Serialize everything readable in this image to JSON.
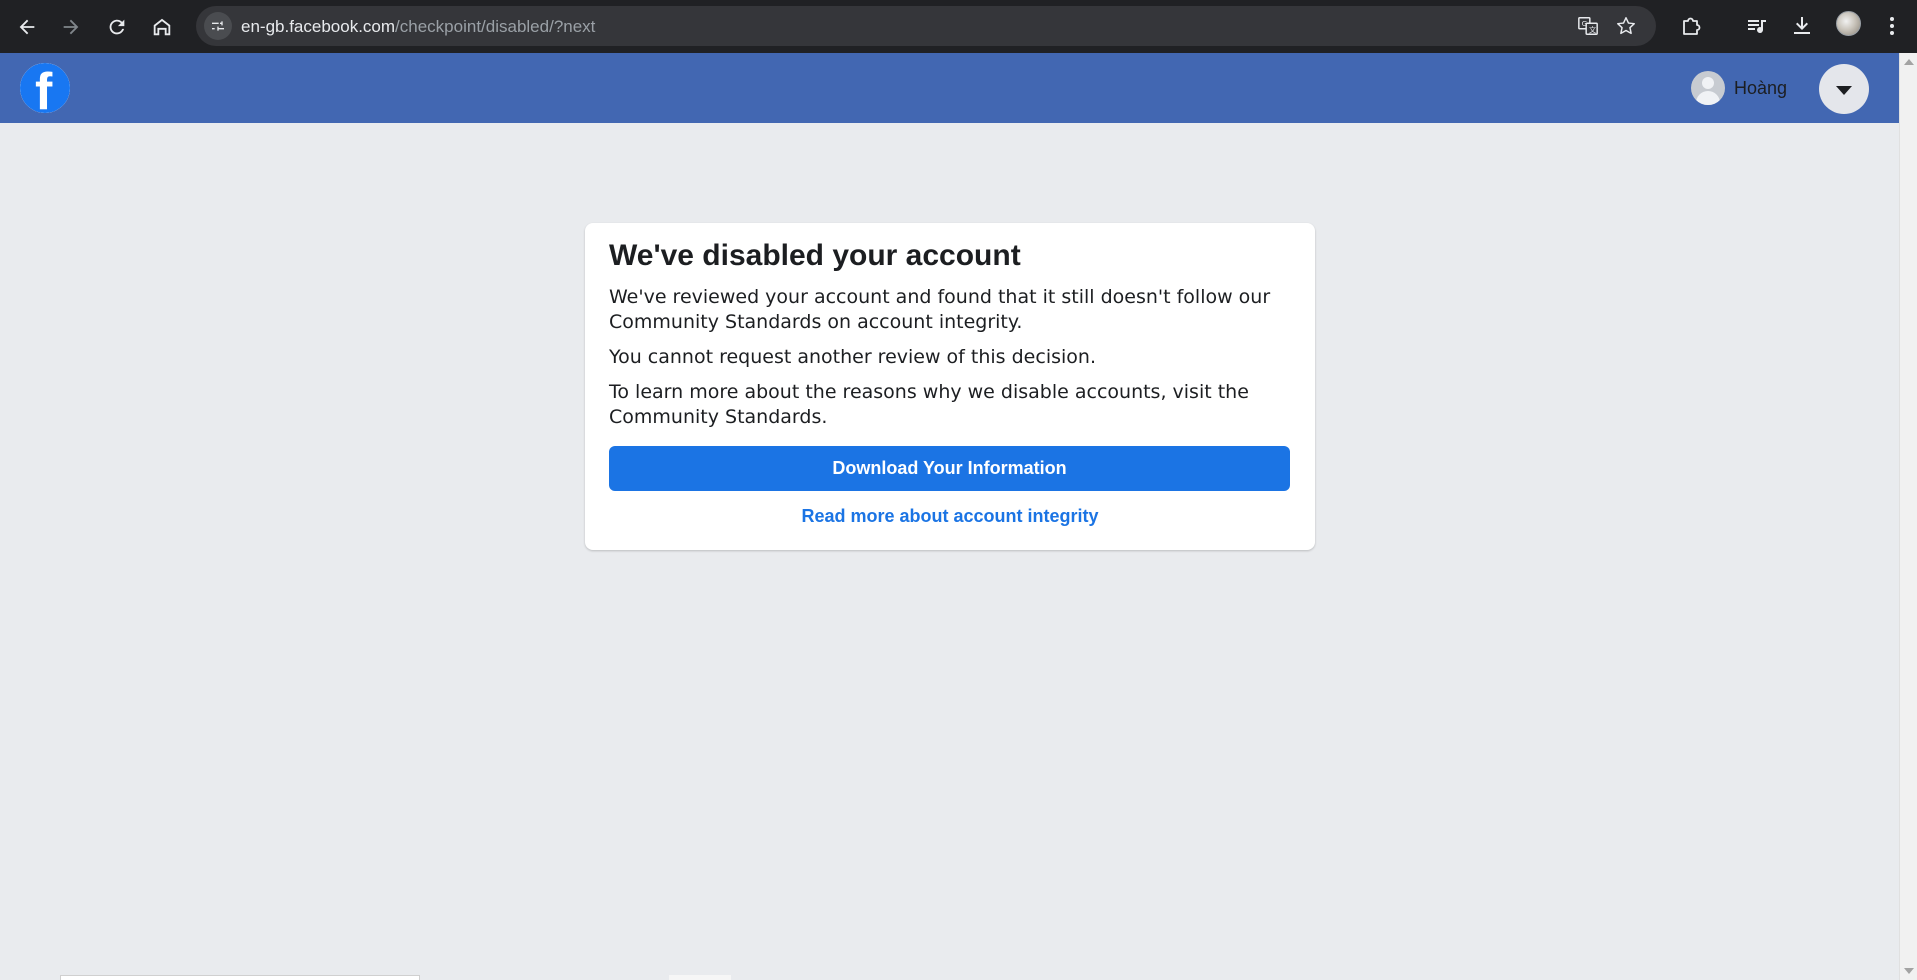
{
  "browser": {
    "url_host": "en-gb.facebook.com",
    "url_path": "/checkpoint/disabled/?next",
    "icons": {
      "back": "arrow-left-icon",
      "forward": "arrow-right-icon",
      "reload": "reload-icon",
      "home": "home-icon",
      "site_info": "tune-icon",
      "translate": "translate-icon",
      "bookmark": "star-icon",
      "extensions": "puzzle-icon",
      "media": "media-control-icon",
      "downloads": "download-icon",
      "menu": "kebab-menu-icon"
    }
  },
  "header": {
    "logo": "facebook-logo",
    "logo_letter": "f",
    "user_name": "Hoàng",
    "brand_color": "#4267b2"
  },
  "card": {
    "title": "We've disabled your account",
    "paragraph1": "We've reviewed your account and found that it still doesn't follow our Community Standards on account integrity.",
    "paragraph2": "You cannot request another review of this decision.",
    "paragraph3": "To learn more about the reasons why we disable accounts, visit the Community Standards.",
    "primary_button": "Download Your Information",
    "link": "Read more about account integrity",
    "accent_color": "#1b74e4"
  }
}
